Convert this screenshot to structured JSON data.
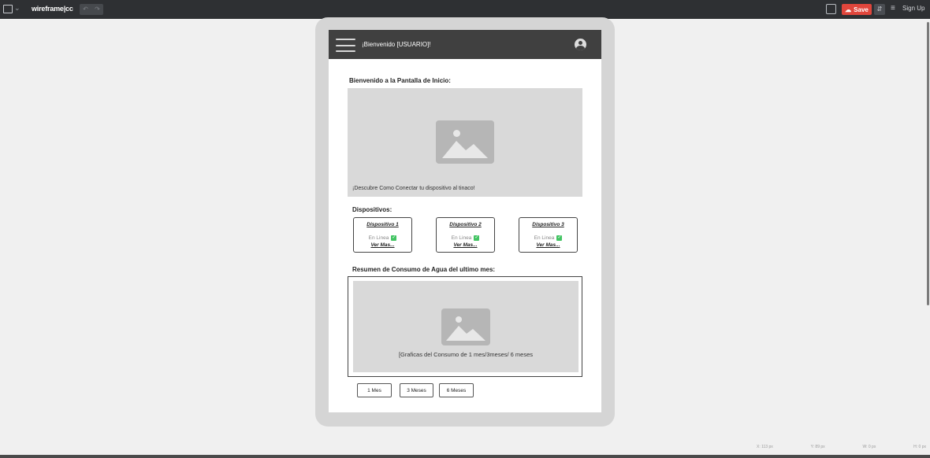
{
  "editor": {
    "brand": "wireframe|cc",
    "undo_label": "↶",
    "redo_label": "↷",
    "save_label": "Save",
    "sign_up_label": "Sign Up",
    "status": {
      "x": "X: 113 px",
      "y": "Y: 89 px",
      "w": "W: 0 px",
      "h": "H: 0 px"
    },
    "accent_color": "#e0463c"
  },
  "app": {
    "header_title": "¡Bienvenido [USUARIO]!",
    "home_title": "Bienvenido a la Pantalla de Inicio:",
    "hero_caption": "¡Descubre Como Conectar tu dispositivo al tinaco!",
    "devices_title": "Dispositivos:",
    "devices": [
      {
        "name": "Dispositivo 1",
        "status": "En Linea",
        "more": "Ver Mas..."
      },
      {
        "name": "Dispositivo 2",
        "status": "En Linea",
        "more": "Ver Mas..."
      },
      {
        "name": "Dispositivo 3",
        "status": "En Linea",
        "more": "Ver Mas..."
      }
    ],
    "summary_title": "Resumen de Consumo de Agua del ultimo mes:",
    "chart_caption": "[Graficas del Consumo de 1 mes/3meses/ 6 meses",
    "ranges": [
      "1 Mes",
      "3 Meses",
      "6 Meses"
    ],
    "status_color": "#43c463"
  }
}
